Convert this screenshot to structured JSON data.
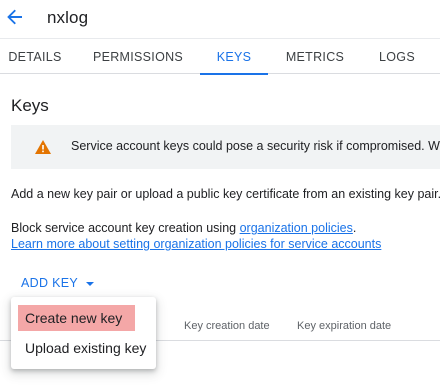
{
  "header": {
    "title": "nxlog"
  },
  "tabs": [
    {
      "label": "DETAILS"
    },
    {
      "label": "PERMISSIONS"
    },
    {
      "label": "KEYS"
    },
    {
      "label": "METRICS"
    },
    {
      "label": "LOGS"
    }
  ],
  "section": {
    "title": "Keys"
  },
  "warning": {
    "text": "Service account keys could pose a security risk if compromised. We rec"
  },
  "intro": {
    "text": "Add a new key pair or upload a public key certificate from an existing key pair."
  },
  "policy": {
    "prefix": "Block service account key creation using ",
    "link": "organization policies",
    "suffix": ".",
    "learn_more": "Learn more about setting organization policies for service accounts"
  },
  "add_key": {
    "label": "ADD KEY"
  },
  "table": {
    "columns": [
      "Key creation date",
      "Key expiration date"
    ]
  },
  "menu": {
    "items": [
      {
        "label": "Create new key"
      },
      {
        "label": "Upload existing key"
      }
    ]
  },
  "colors": {
    "accent": "#1a73e8",
    "warning": "#e37400",
    "highlight": "#f4a7a7"
  }
}
